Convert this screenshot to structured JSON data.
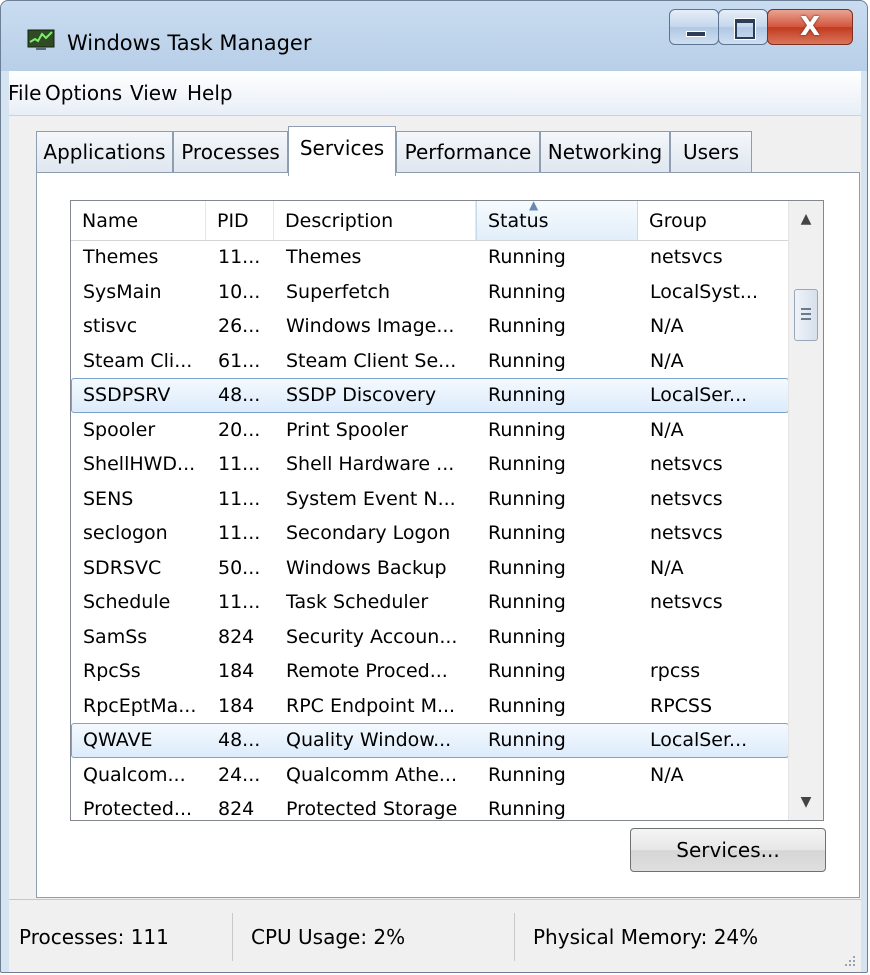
{
  "window": {
    "title": "Windows Task Manager"
  },
  "menu": [
    "File",
    "Options",
    "View",
    "Help"
  ],
  "tabs": [
    "Applications",
    "Processes",
    "Services",
    "Performance",
    "Networking",
    "Users"
  ],
  "active_tab": "Services",
  "columns": [
    "Name",
    "PID",
    "Description",
    "Status",
    "Group"
  ],
  "sorted_column": "Status",
  "rows": [
    {
      "name": "Themes",
      "pid": "11...",
      "description": "Themes",
      "status": "Running",
      "group": "netsvcs"
    },
    {
      "name": "SysMain",
      "pid": "10...",
      "description": "Superfetch",
      "status": "Running",
      "group": "LocalSyst..."
    },
    {
      "name": "stisvc",
      "pid": "26...",
      "description": "Windows Image...",
      "status": "Running",
      "group": "N/A"
    },
    {
      "name": "Steam Cli...",
      "pid": "61...",
      "description": "Steam Client Se...",
      "status": "Running",
      "group": "N/A"
    },
    {
      "name": "SSDPSRV",
      "pid": "48...",
      "description": "SSDP Discovery",
      "status": "Running",
      "group": "LocalSer...",
      "selected": true
    },
    {
      "name": "Spooler",
      "pid": "20...",
      "description": "Print Spooler",
      "status": "Running",
      "group": "N/A"
    },
    {
      "name": "ShellHWD...",
      "pid": "11...",
      "description": "Shell Hardware ...",
      "status": "Running",
      "group": "netsvcs"
    },
    {
      "name": "SENS",
      "pid": "11...",
      "description": "System Event N...",
      "status": "Running",
      "group": "netsvcs"
    },
    {
      "name": "seclogon",
      "pid": "11...",
      "description": "Secondary Logon",
      "status": "Running",
      "group": "netsvcs"
    },
    {
      "name": "SDRSVC",
      "pid": "50...",
      "description": "Windows Backup",
      "status": "Running",
      "group": "N/A"
    },
    {
      "name": "Schedule",
      "pid": "11...",
      "description": "Task Scheduler",
      "status": "Running",
      "group": "netsvcs"
    },
    {
      "name": "SamSs",
      "pid": "824",
      "description": "Security Accoun...",
      "status": "Running",
      "group": ""
    },
    {
      "name": "RpcSs",
      "pid": "184",
      "description": "Remote Proced...",
      "status": "Running",
      "group": "rpcss"
    },
    {
      "name": "RpcEptMa...",
      "pid": "184",
      "description": "RPC Endpoint M...",
      "status": "Running",
      "group": "RPCSS"
    },
    {
      "name": "QWAVE",
      "pid": "48...",
      "description": "Quality Window...",
      "status": "Running",
      "group": "LocalSer...",
      "selected": true
    },
    {
      "name": "Qualcom...",
      "pid": "24...",
      "description": "Qualcomm Athe...",
      "status": "Running",
      "group": "N/A"
    },
    {
      "name": "Protected...",
      "pid": "824",
      "description": "Protected Storage",
      "status": "Running",
      "group": ""
    }
  ],
  "buttons": {
    "services": "Services..."
  },
  "status": {
    "processes": "Processes: 111",
    "cpu": "CPU Usage: 2%",
    "memory": "Physical Memory: 24%"
  },
  "icons": [
    "task-manager-icon",
    "minimize-icon",
    "maximize-icon",
    "close-icon",
    "sort-ascending-icon",
    "scroll-up-icon",
    "scroll-down-icon",
    "resize-grip-icon"
  ]
}
